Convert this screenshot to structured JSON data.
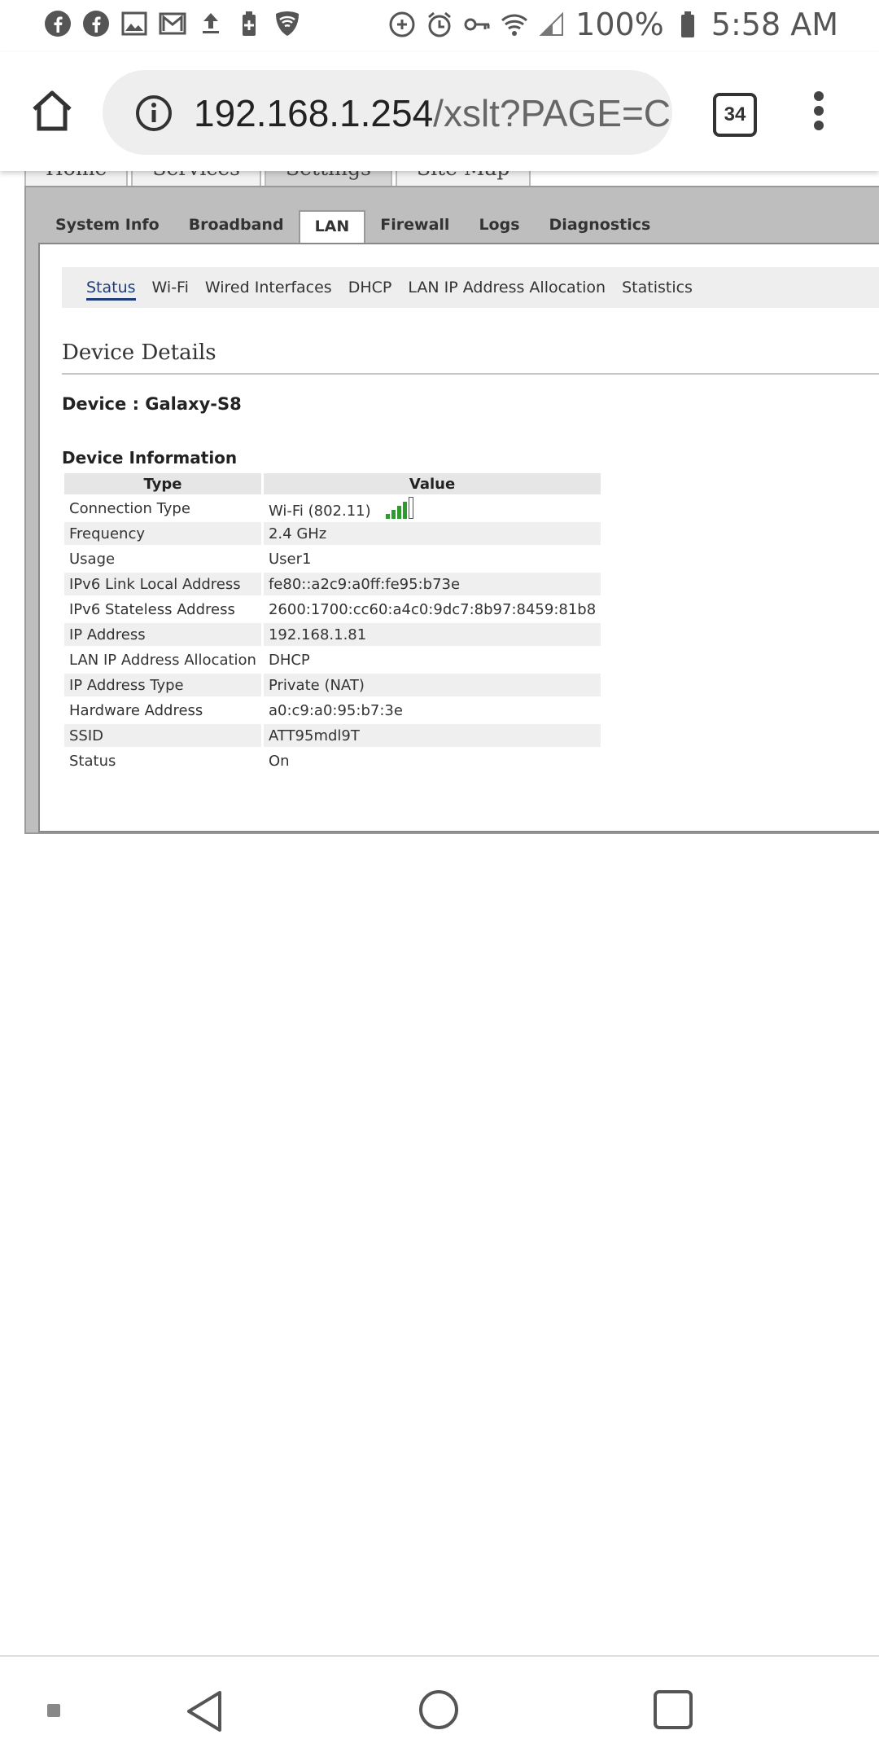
{
  "status_bar": {
    "left_icons": [
      "facebook-icon",
      "facebook-icon",
      "image-icon",
      "gmail-icon",
      "upload-icon",
      "battery-saver-icon",
      "shield-wifi-icon"
    ],
    "right_icons": [
      "data-saver-icon",
      "alarm-icon",
      "vpn-key-icon",
      "wifi-icon",
      "cell-signal-icon"
    ],
    "battery": "100%",
    "time": "5:58 AM"
  },
  "browser": {
    "url_host": "192.168.1.254",
    "url_path": "/xslt?PAGE=C",
    "tab_count": "34"
  },
  "site": {
    "top_tabs": [
      "Home",
      "Services",
      "Settings",
      "Site Map"
    ],
    "top_tab_active": "Settings",
    "sub_tabs": [
      "System Info",
      "Broadband",
      "LAN",
      "Firewall",
      "Logs",
      "Diagnostics"
    ],
    "sub_tab_active": "LAN",
    "lan_nav": [
      "Status",
      "Wi-Fi",
      "Wired Interfaces",
      "DHCP",
      "LAN IP Address Allocation",
      "Statistics"
    ],
    "lan_nav_active": "Status"
  },
  "details": {
    "section_title": "Device Details",
    "device_line": "Device : Galaxy-S8",
    "info_heading": "Device Information",
    "col_type": "Type",
    "col_value": "Value",
    "signal_level": "4 of 5 bars",
    "rows": [
      {
        "type": "Connection Type",
        "value": "Wi-Fi (802.11)"
      },
      {
        "type": "Frequency",
        "value": "2.4 GHz"
      },
      {
        "type": "Usage",
        "value": "User1"
      },
      {
        "type": "IPv6 Link Local Address",
        "value": "fe80::a2c9:a0ff:fe95:b73e"
      },
      {
        "type": "IPv6 Stateless Address",
        "value": "2600:1700:cc60:a4c0:9dc7:8b97:8459:81b8"
      },
      {
        "type": "IP Address",
        "value": "192.168.1.81"
      },
      {
        "type": "LAN IP Address Allocation",
        "value": "DHCP"
      },
      {
        "type": "IP Address Type",
        "value": "Private (NAT)"
      },
      {
        "type": "Hardware Address",
        "value": "a0:c9:a0:95:b7:3e"
      },
      {
        "type": "SSID",
        "value": "ATT95mdl9T"
      },
      {
        "type": "Status",
        "value": "On"
      }
    ]
  },
  "system_nav": [
    "recents-small-icon",
    "back-icon",
    "home-circle-icon",
    "overview-icon"
  ]
}
